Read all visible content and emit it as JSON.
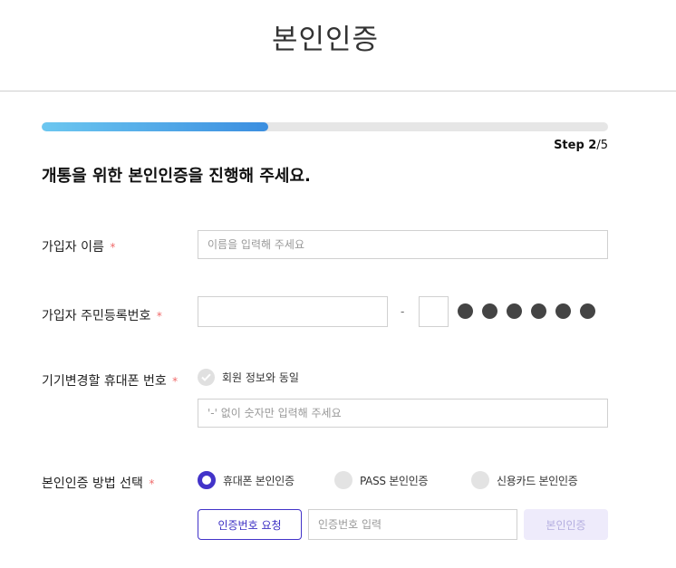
{
  "header": {
    "title": "본인인증"
  },
  "progress": {
    "fraction": 0.4,
    "step_prefix": "Step ",
    "step_current": "2",
    "step_total": "/5"
  },
  "instruction": "개통을 위한 본인인증을 진행해 주세요.",
  "required_mark": "*",
  "fields": {
    "name": {
      "label": "가입자 이름",
      "placeholder": "이름을 입력해 주세요",
      "value": ""
    },
    "resident_number": {
      "label": "가입자 주민등록번호",
      "front_value": "",
      "separator": "-",
      "back_first_value": "",
      "masked_digits": 6
    },
    "phone": {
      "label": "기기변경할 휴대폰 번호",
      "same_as_member_label": "회원 정보와 동일",
      "placeholder": "'-' 없이 숫자만 입력해 주세요",
      "value": ""
    },
    "auth_method": {
      "label": "본인인증 방법 선택",
      "options": [
        {
          "label": "휴대폰 본인인증",
          "selected": true
        },
        {
          "label": "PASS 본인인증",
          "selected": false
        },
        {
          "label": "신용카드 본인인증",
          "selected": false
        }
      ],
      "request_button": "인증번호 요청",
      "code_placeholder": "인증번호 입력",
      "verify_button": "본인인증"
    }
  },
  "colors": {
    "accent": "#4233c9",
    "progress_start": "#6cc7f0",
    "progress_end": "#3b8ee0",
    "required": "#f06a6a"
  },
  "icons": {
    "check": "check-icon",
    "masked_dot": "masked-digit-dot"
  }
}
